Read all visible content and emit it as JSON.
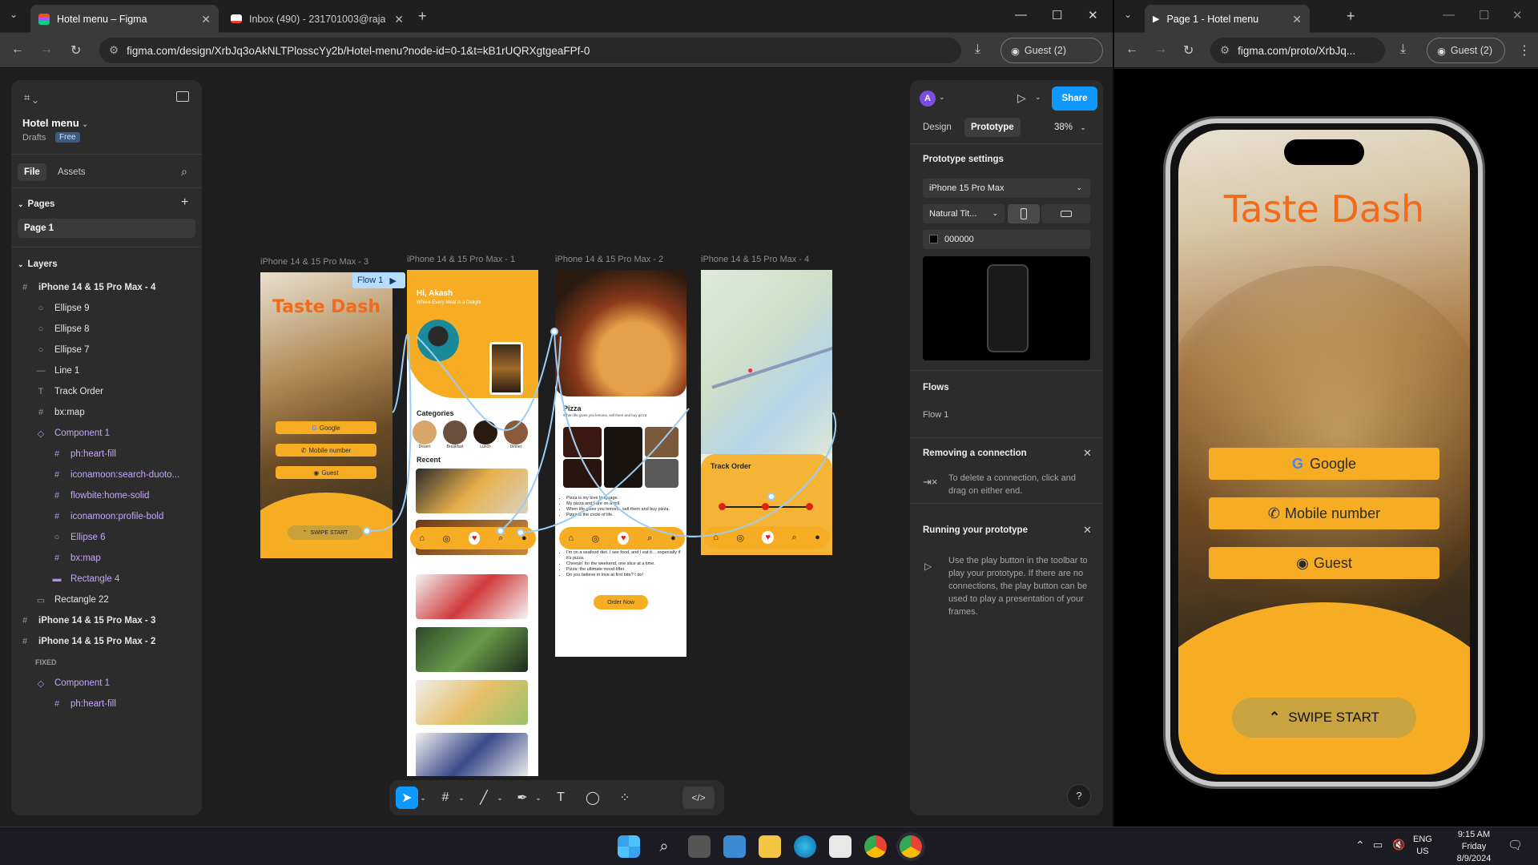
{
  "tabs_left": [
    {
      "title": "Hotel menu – Figma",
      "close": "✕"
    },
    {
      "title": "Inbox (490) - 231701003@rajal",
      "close": "✕"
    }
  ],
  "tabs_right": [
    {
      "title": "Page 1 - Hotel menu",
      "close": "✕"
    }
  ],
  "url_left": "figma.com/design/XrbJq3oAkNLTPlosscYy2b/Hotel-menu?node-id=0-1&t=kB1rUQRXgtgeaFPf-0",
  "url_right": "figma.com/proto/XrbJq...",
  "guest_label": "Guest (2)",
  "file": {
    "name": "Hotel menu",
    "drafts": "Drafts",
    "plan": "Free"
  },
  "panel_tabs": {
    "file": "File",
    "assets": "Assets"
  },
  "pages": {
    "header": "Pages",
    "items": [
      "Page 1"
    ]
  },
  "layers": {
    "header": "Layers",
    "items": [
      {
        "label": "iPhone 14 & 15 Pro Max - 4",
        "icon": "#"
      },
      {
        "label": "Ellipse 9",
        "icon": "○"
      },
      {
        "label": "Ellipse 8",
        "icon": "○"
      },
      {
        "label": "Ellipse 7",
        "icon": "○"
      },
      {
        "label": "Line 1",
        "icon": "—"
      },
      {
        "label": "Track Order",
        "icon": "T"
      },
      {
        "label": "bx:map",
        "icon": "#"
      },
      {
        "label": "Component 1",
        "icon": "◇"
      },
      {
        "label": "ph:heart-fill",
        "icon": "#"
      },
      {
        "label": "iconamoon:search-duoto...",
        "icon": "#"
      },
      {
        "label": "flowbite:home-solid",
        "icon": "#"
      },
      {
        "label": "iconamoon:profile-bold",
        "icon": "#"
      },
      {
        "label": "Ellipse 6",
        "icon": "○"
      },
      {
        "label": "bx:map",
        "icon": "#"
      },
      {
        "label": "Rectangle 4",
        "icon": "▬"
      },
      {
        "label": "Rectangle 22",
        "icon": "▭"
      },
      {
        "label": "iPhone 14 & 15 Pro Max - 3",
        "icon": "#"
      },
      {
        "label": "iPhone 14 & 15 Pro Max - 2",
        "icon": "#"
      },
      {
        "label": "FIXED",
        "icon": ""
      },
      {
        "label": "Component 1",
        "icon": "◇"
      },
      {
        "label": "ph:heart-fill",
        "icon": "#"
      }
    ]
  },
  "frames": {
    "f3": {
      "label": "iPhone 14 & 15 Pro Max - 3",
      "title": "Taste Dash",
      "btn_google": "Google",
      "btn_mobile": "Mobile number",
      "btn_guest": "Guest",
      "swipe": "SWIPE START"
    },
    "f1": {
      "label": "iPhone 14 & 15 Pro Max - 1",
      "greeting": "Hi, Akash",
      "tagline": "Where Every Meal is a Delight",
      "categories": "Categories",
      "cats": [
        "Desert",
        "Breakfast",
        "Lunch",
        "Dinner"
      ],
      "recent": "Recent"
    },
    "f2": {
      "label": "iPhone 14 & 15 Pro Max - 2",
      "title": "Pizza",
      "subtitle": "When life gives you lemons, sell them and buy pizza",
      "bullets": [
        "Pizza is my love language.",
        "My pizza and I are on a roll.",
        "When life gives you lemons, sell them and buy pizza.",
        "Pizza is the circle of life."
      ],
      "bullets2": [
        "I'm on a seafood diet. I see food, and I eat it… especially if it's pizza.",
        "Cheesin' for the weekend, one slice at a time.",
        "Pizza: the ultimate mood-lifter.",
        "Do you believe in love at first bite? I do!"
      ],
      "order": "Order Now"
    },
    "f4": {
      "label": "iPhone 14 & 15 Pro Max - 4",
      "track": "Track Order"
    },
    "flow_badge": "Flow 1"
  },
  "right_panel": {
    "avatar": "A",
    "share": "Share",
    "tab_design": "Design",
    "tab_prototype": "Prototype",
    "zoom": "38%",
    "proto_settings": "Prototype settings",
    "device": "iPhone 15 Pro Max",
    "device_model": "Natural Tit...",
    "bg_color": "000000",
    "flows_header": "Flows",
    "flow_item": "Flow 1",
    "removing_title": "Removing a connection",
    "removing_text": "To delete a connection, click and drag on either end.",
    "running_title": "Running your prototype",
    "running_text": "Use the play button in the toolbar to play your prototype. If there are no connections, the play button can be used to play a presentation of your frames.",
    "help": "?"
  },
  "proto_screen": {
    "title": "Taste Dash",
    "google": "Google",
    "mobile": "Mobile number",
    "guest": "Guest",
    "swipe": "SWIPE START"
  },
  "tray": {
    "lang1": "ENG",
    "lang2": "US",
    "time": "9:15 AM",
    "day": "Friday",
    "date": "8/9/2024"
  },
  "colors": {
    "accent": "#f6ad23",
    "title_orange": "#f26a1b",
    "figma_blue": "#0d99ff"
  }
}
